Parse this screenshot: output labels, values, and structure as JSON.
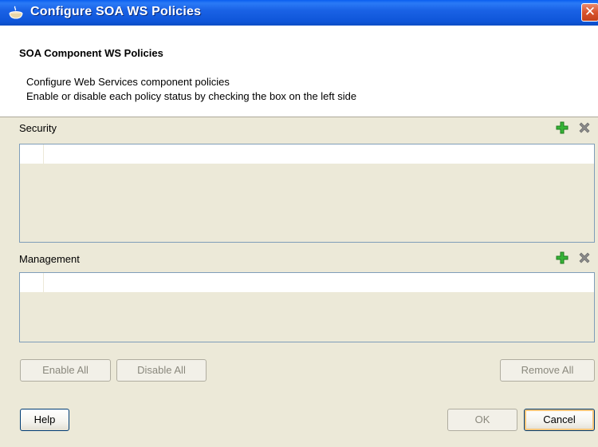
{
  "window": {
    "title": "Configure SOA WS Policies",
    "close_glyph": "✕"
  },
  "header": {
    "title": "SOA Component WS Policies",
    "description_line1": "Configure Web Services component policies",
    "description_line2": "Enable or disable each policy status by checking the box on the left side"
  },
  "security": {
    "label": "Security",
    "add_icon": "add-icon",
    "remove_icon": "remove-icon"
  },
  "management": {
    "label": "Management",
    "add_icon": "add-icon",
    "remove_icon": "remove-icon"
  },
  "actions": {
    "enable_all": "Enable All",
    "disable_all": "Disable All",
    "remove_all": "Remove All"
  },
  "footer": {
    "help": "Help",
    "ok": "OK",
    "cancel": "Cancel"
  },
  "colors": {
    "titlebar": "#0e55d8",
    "add_icon": "#2aa12a",
    "remove_icon": "#7a7a7a"
  }
}
